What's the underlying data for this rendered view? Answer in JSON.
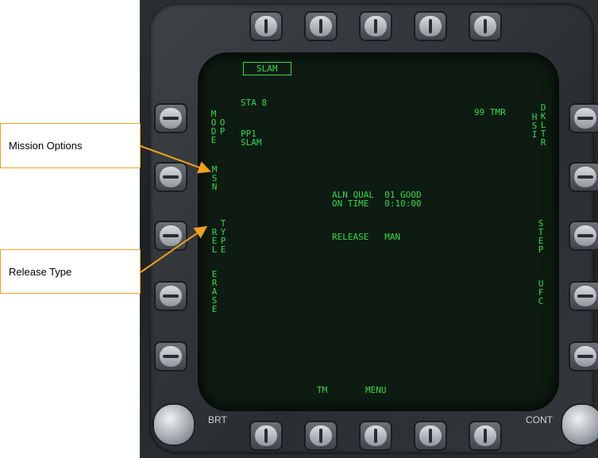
{
  "display": {
    "title_box": "SLAM",
    "station": "STA 8",
    "pp_line1": "PP1",
    "pp_line2": "SLAM",
    "timer": "99 TMR",
    "aln_qual": "ALN QUAL  01 GOOD",
    "on_time": "ON TIME   0:10:00",
    "release": "RELEASE   MAN",
    "left_osb": {
      "mode": "MODE",
      "op": "OP",
      "msn": "MSN",
      "rel": "REL",
      "type": "TYPE",
      "erase": "ERASE"
    },
    "right_osb": {
      "hsi": "HSI",
      "dkltr": "DKLTR",
      "step": "STEP",
      "ufc": "UFC"
    },
    "bottom": {
      "tm": "TM",
      "menu": "MENU"
    }
  },
  "controls": {
    "brt": "BRT",
    "cont": "CONT"
  },
  "callouts": {
    "mission_options": "Mission Options",
    "release_type": "Release Type"
  },
  "colors": {
    "display_text": "#39d84a",
    "callout_border": "#f0a020"
  }
}
